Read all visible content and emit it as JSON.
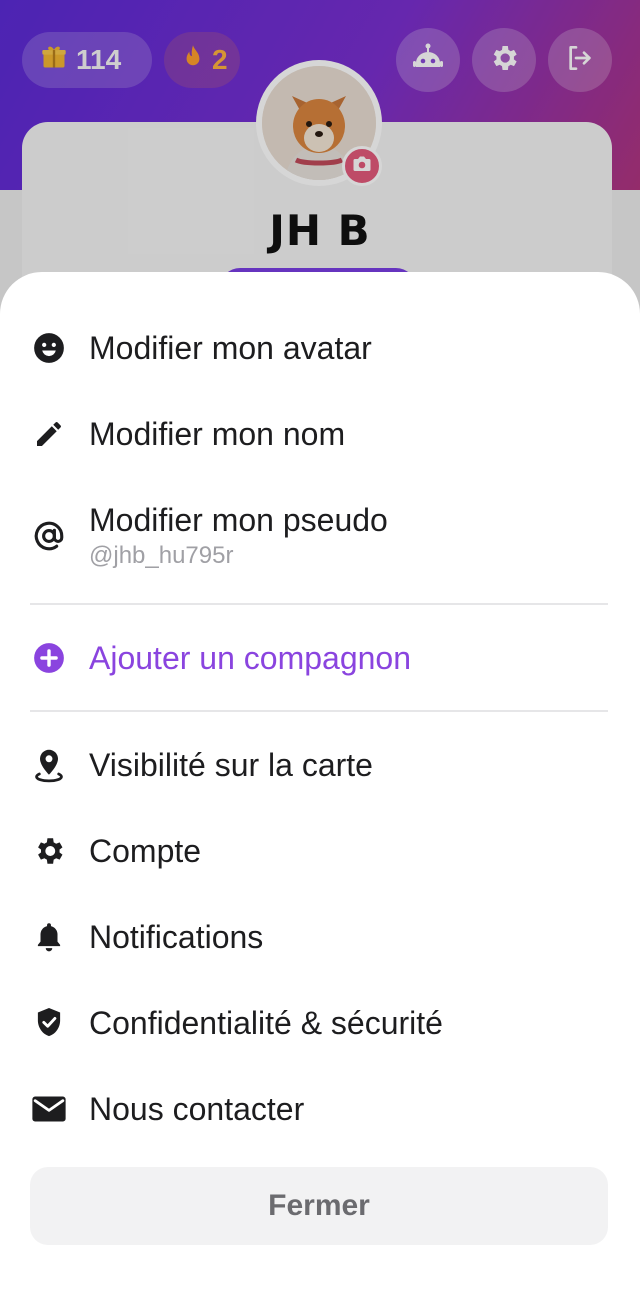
{
  "header": {
    "gifts_count": "114",
    "streak_count": "2"
  },
  "profile": {
    "name": "JH B"
  },
  "menu": {
    "items": [
      {
        "label": "Modifier mon avatar",
        "icon": "smiley-icon"
      },
      {
        "label": "Modifier mon nom",
        "icon": "pencil-icon"
      },
      {
        "label": "Modifier mon pseudo",
        "sub": "@jhb_hu795r",
        "icon": "at-sign-icon"
      },
      {
        "label": "Ajouter un compagnon",
        "icon": "plus-circle-icon"
      },
      {
        "label": "Visibilité sur la carte",
        "icon": "map-pin-icon"
      },
      {
        "label": "Compte",
        "icon": "gear-icon"
      },
      {
        "label": "Notifications",
        "icon": "bell-icon"
      },
      {
        "label": "Confidentialité & sécurité",
        "icon": "shield-check-icon"
      },
      {
        "label": "Nous contacter",
        "icon": "envelope-icon"
      }
    ],
    "close_label": "Fermer"
  },
  "colors": {
    "accent": "#8a44df",
    "text": "#1d1d1f",
    "subtext": "#a0a0a5",
    "hero_start": "#5b2bd6",
    "hero_end": "#b1357f"
  }
}
